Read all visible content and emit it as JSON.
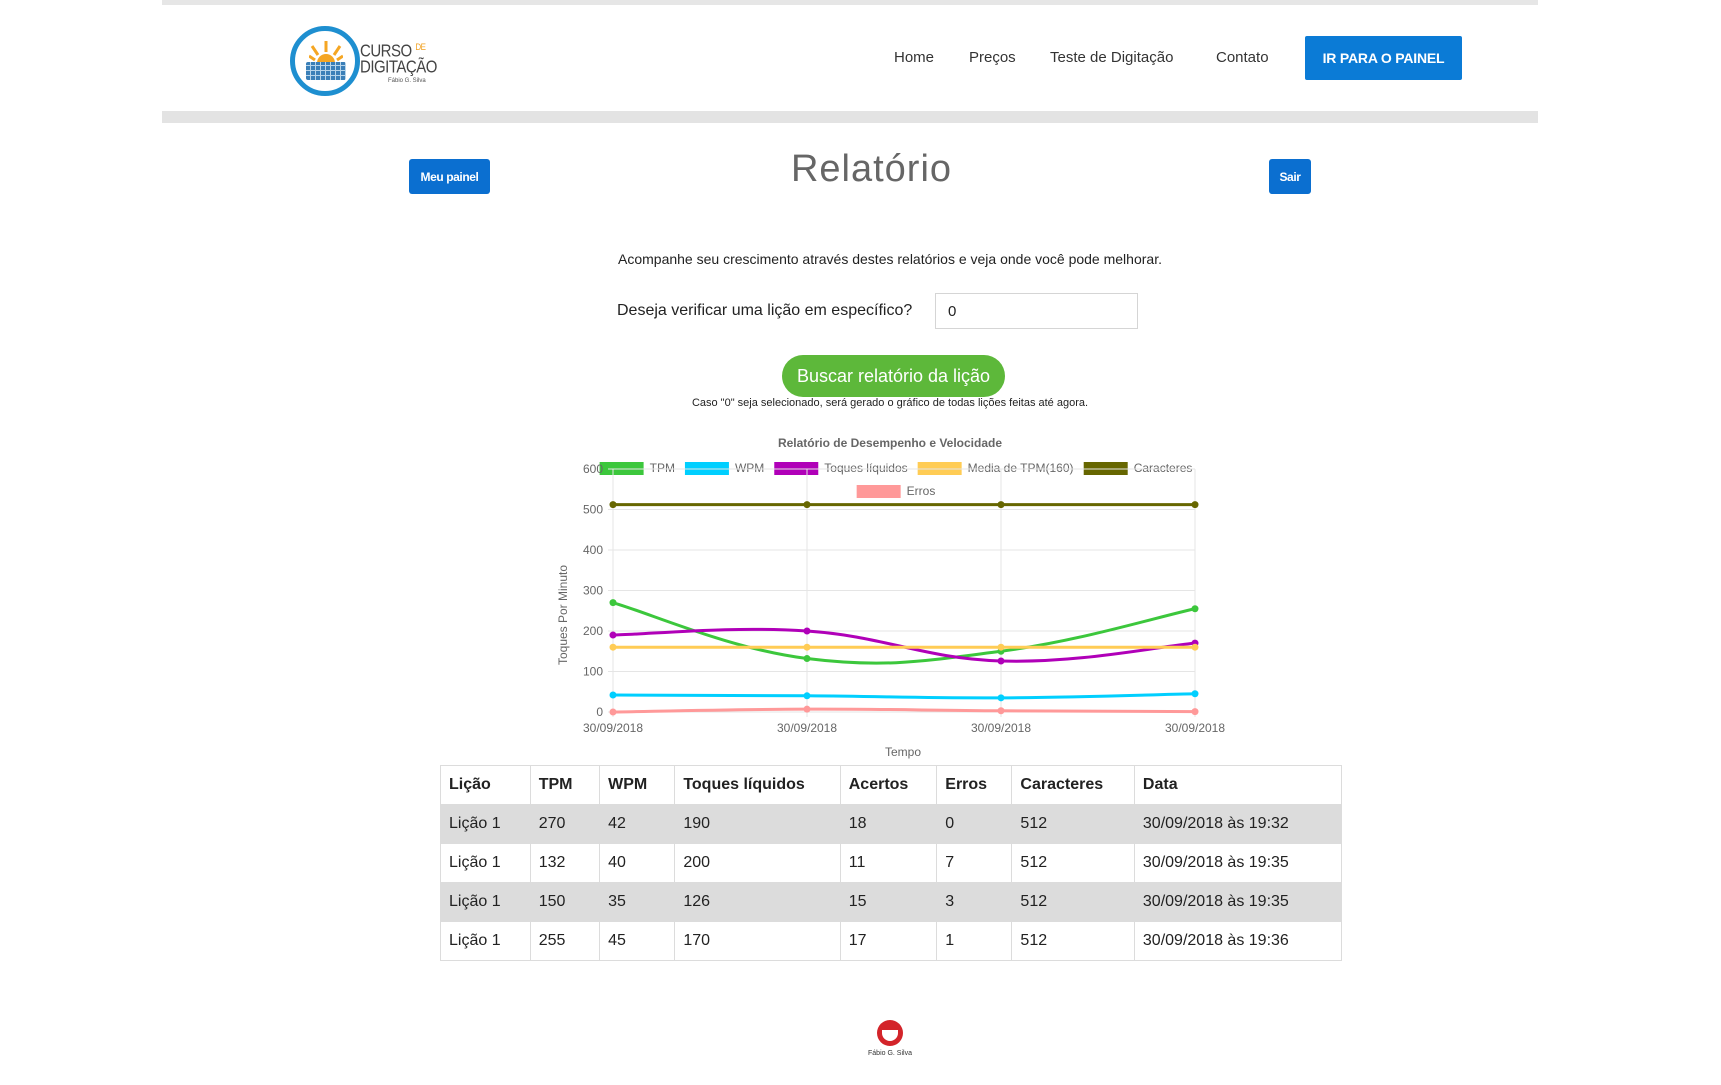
{
  "brand": {
    "logo_line1": "CURSO",
    "logo_line1_small": "DE",
    "logo_line2": "DIGITAÇÃO",
    "logo_signature": "Fábio G. Silva"
  },
  "nav": {
    "items": [
      "Home",
      "Preços",
      "Teste de Digitação",
      "Contato"
    ],
    "cta": "IR PARA O PAINEL"
  },
  "page": {
    "title": "Relatório",
    "left_button": "Meu painel",
    "right_button": "Sair",
    "intro": "Acompanhe seu crescimento através destes relatórios e veja onde você pode melhorar.",
    "lesson_question": "Deseja verificar uma lição em específico?",
    "lesson_value": "0",
    "search_button": "Buscar relatório da lição",
    "note": "Caso \"0\" seja selecionado, será gerado o gráfico de todas lições feitas até agora."
  },
  "chart_data": {
    "type": "line",
    "title": "Relatório de Desempenho e Velocidade",
    "xlabel": "Tempo",
    "ylabel": "Toques Por Minuto",
    "categories": [
      "30/09/2018",
      "30/09/2018",
      "30/09/2018",
      "30/09/2018"
    ],
    "ylim": [
      0,
      600
    ],
    "yticks": [
      0,
      100,
      200,
      300,
      400,
      500,
      600
    ],
    "grid": true,
    "legend_position": "top",
    "series": [
      {
        "name": "TPM",
        "color": "#3cc73c",
        "values": [
          270,
          132,
          150,
          255
        ]
      },
      {
        "name": "WPM",
        "color": "#00cfff",
        "values": [
          42,
          40,
          35,
          45
        ]
      },
      {
        "name": "Toques líquidos",
        "color": "#b000b8",
        "values": [
          190,
          200,
          126,
          170
        ]
      },
      {
        "name": "Media de TPM(160)",
        "color": "#ffcc55",
        "values": [
          160,
          160,
          160,
          160
        ]
      },
      {
        "name": "Caracteres",
        "color": "#666600",
        "values": [
          512,
          512,
          512,
          512
        ]
      },
      {
        "name": "Erros",
        "color": "#ff9999",
        "values": [
          0,
          7,
          3,
          1
        ]
      }
    ]
  },
  "table": {
    "headers": [
      "Lição",
      "TPM",
      "WPM",
      "Toques líquidos",
      "Acertos",
      "Erros",
      "Caracteres",
      "Data"
    ],
    "rows": [
      [
        "Lição 1",
        "270",
        "42",
        "190",
        "18",
        "0",
        "512",
        "30/09/2018 às 19:32"
      ],
      [
        "Lição 1",
        "132",
        "40",
        "200",
        "11",
        "7",
        "512",
        "30/09/2018 às 19:35"
      ],
      [
        "Lição 1",
        "150",
        "35",
        "126",
        "15",
        "3",
        "512",
        "30/09/2018 às 19:35"
      ],
      [
        "Lição 1",
        "255",
        "45",
        "170",
        "17",
        "1",
        "512",
        "30/09/2018 às 19:36"
      ]
    ]
  },
  "footer": {
    "signature": "Fábio G. Silva"
  }
}
